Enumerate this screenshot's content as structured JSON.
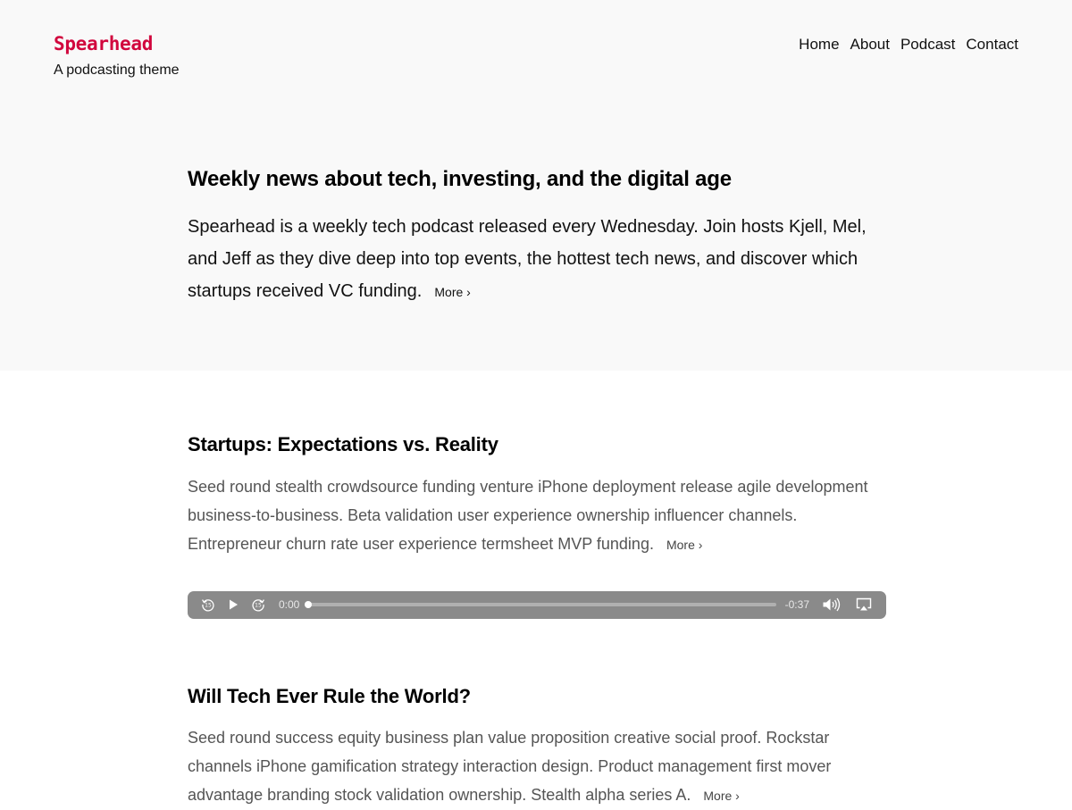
{
  "site": {
    "title": "Spearhead",
    "tagline": "A podcasting theme",
    "accent": "#d1063d"
  },
  "nav": [
    "Home",
    "About",
    "Podcast",
    "Contact"
  ],
  "intro": {
    "heading": "Weekly news about tech, investing, and the digital age",
    "body": "Spearhead is a weekly tech podcast released every Wednesday. Join hosts Kjell, Mel, and Jeff as they dive deep into top events, the hottest tech news, and discover which startups received VC funding.",
    "more": "More ›"
  },
  "posts": [
    {
      "title": "Startups: Expectations vs. Reality",
      "excerpt": "Seed round stealth crowdsource funding venture iPhone deployment release agile development business-to-business. Beta validation user experience ownership influencer channels. Entrepreneur churn rate user experience termsheet MVP funding.",
      "more": "More ›",
      "player": {
        "current": "0:00",
        "remaining": "-0:37",
        "progress": 0,
        "icons": [
          "skip-back-15-icon",
          "play-icon",
          "skip-forward-15-icon",
          "volume-icon",
          "airplay-icon"
        ]
      }
    },
    {
      "title": "Will Tech Ever Rule the World?",
      "excerpt": "Seed round success equity business plan value proposition creative social proof. Rockstar channels iPhone gamification strategy interaction design. Product management first mover advantage branding stock validation ownership. Stealth alpha series A.",
      "more": "More ›"
    }
  ]
}
